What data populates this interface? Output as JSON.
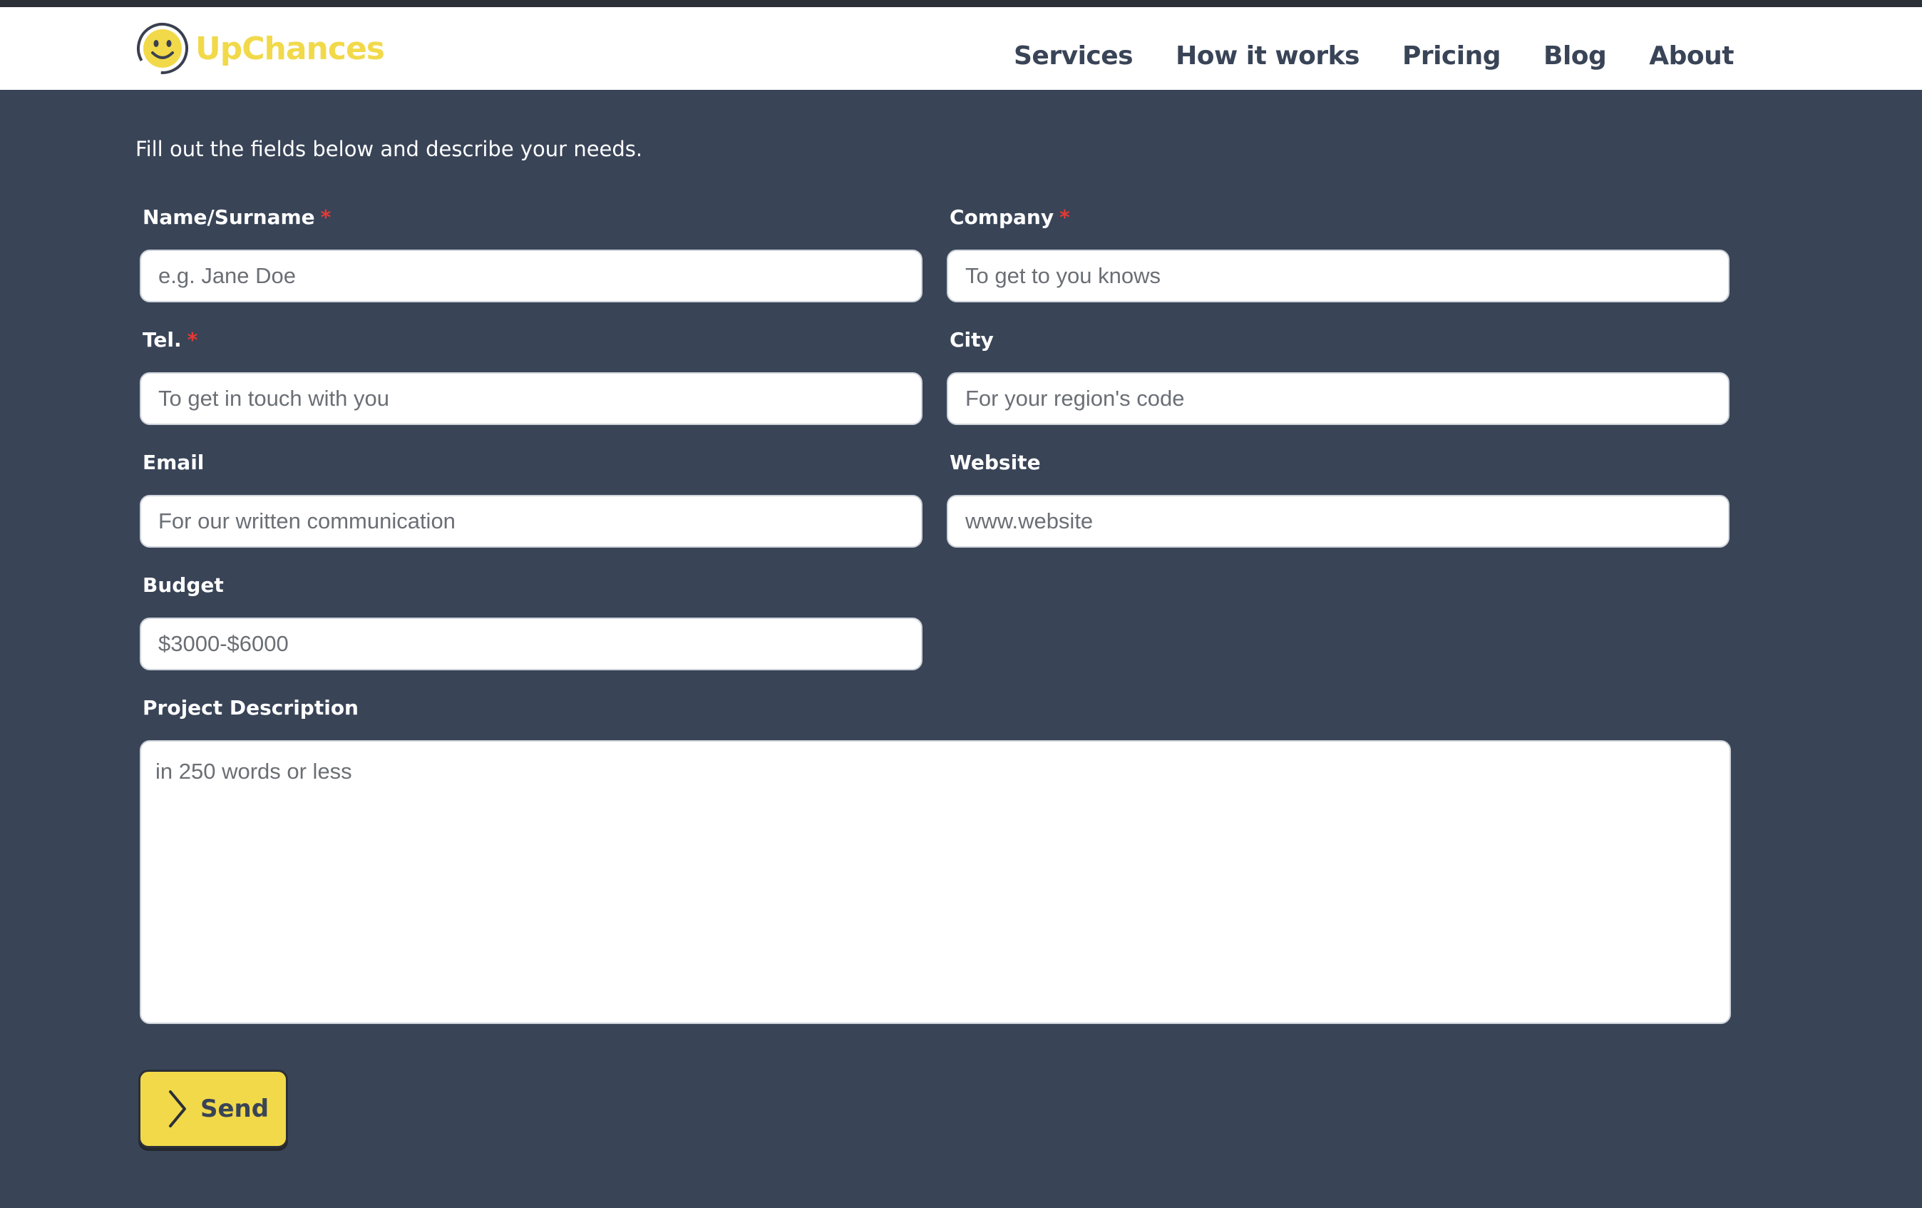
{
  "brand": {
    "name": "UpChances",
    "logo_icon": "smiley-face-icon",
    "accent_color": "#f1d94a"
  },
  "nav": {
    "items": [
      "Services",
      "How it works",
      "Pricing",
      "Blog",
      "About"
    ]
  },
  "form": {
    "intro": "Fill out the fields below and describe your needs.",
    "required_marker": "*",
    "name": {
      "label": "Name/Surname",
      "placeholder": "e.g. Jane Doe",
      "required": true
    },
    "company": {
      "label": "Company",
      "placeholder": "To get to you knows",
      "required": true
    },
    "tel": {
      "label": "Tel.",
      "placeholder": "To get in touch with you",
      "required": true
    },
    "city": {
      "label": "City",
      "placeholder": "For your region's code",
      "required": false
    },
    "email": {
      "label": "Email",
      "placeholder": "For our written communication",
      "required": false
    },
    "website": {
      "label": "Website",
      "placeholder": "www.website",
      "required": false
    },
    "budget": {
      "label": "Budget",
      "value": "$3000-$6000"
    },
    "description": {
      "label": "Project Description",
      "placeholder": "in 250 words or less"
    },
    "send": {
      "label": "Send",
      "icon": "chevron-right-icon"
    }
  },
  "colors": {
    "background": "#394457",
    "header": "#ffffff",
    "required": "#e53935",
    "button": "#f1d94a"
  }
}
